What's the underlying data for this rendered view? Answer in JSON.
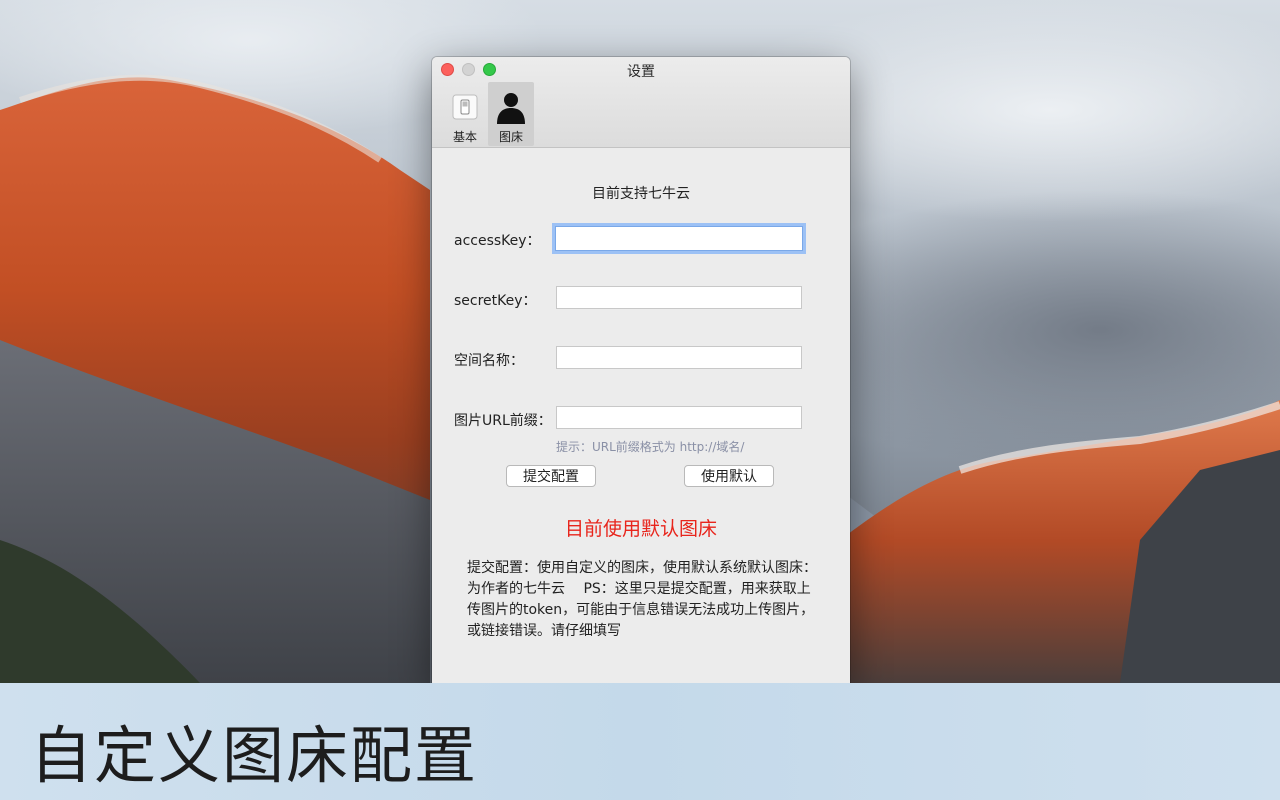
{
  "window": {
    "title": "设置",
    "toolbar": [
      {
        "label": "基本",
        "icon": "switch-icon"
      },
      {
        "label": "图床",
        "icon": "user-silhouette-icon"
      }
    ]
  },
  "form": {
    "heading": "目前支持七牛云",
    "access_key_label": "accessKey：",
    "access_key_value": "",
    "secret_key_label": "secretKey：",
    "secret_key_value": "",
    "bucket_label": "空间名称：",
    "bucket_value": "",
    "url_prefix_label": "图片URL前缀：",
    "url_prefix_value": "",
    "hint": "提示：URL前缀格式为  http://域名/",
    "submit_label": "提交配置",
    "default_label": "使用默认",
    "status": "目前使用默认图床",
    "note": "提交配置：使用自定义的图床，使用默认系统默认图床：为作者的七牛云　 PS：这里只是提交配置，用来获取上传图片的token，可能由于信息错误无法成功上传图片，或链接错误。请仔细填写"
  },
  "caption": "自定义图床配置",
  "colors": {
    "status_red": "#e8251c",
    "focus_ring": "#9cc1f5",
    "caption_band": "#c4d9ea"
  }
}
